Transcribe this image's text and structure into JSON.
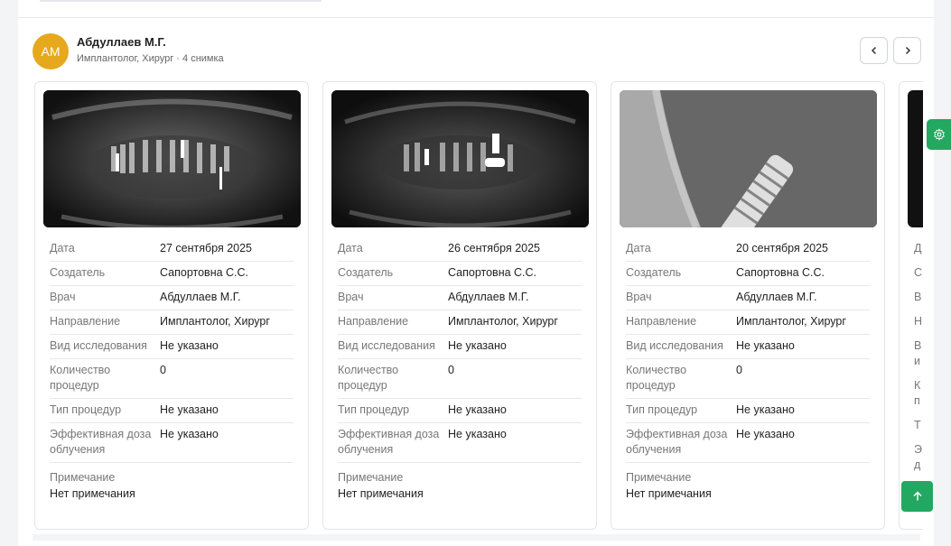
{
  "doctor": {
    "initials": "АМ",
    "name": "Абдуллаев М.Г.",
    "subtitle": "Имплантолог, Хирург · 4 снимка",
    "avatar_color": "#e6a91d"
  },
  "nav": {
    "prev_icon": "chevron-left-icon",
    "next_icon": "chevron-right-icon"
  },
  "labels": {
    "date": "Дата",
    "creator": "Создатель",
    "doctor": "Врач",
    "direction": "Направление",
    "study_type": "Вид исследования",
    "procedures_count": "Количество процедур",
    "procedure_type": "Тип процедур",
    "effective_dose": "Эффективная доза облучения",
    "note": "Примечание"
  },
  "cards": [
    {
      "image": "panoramic-xray",
      "date": "27 сентября 2025",
      "creator": "Сапортовна С.С.",
      "doctor": "Абдуллаев М.Г.",
      "direction": "Имплантолог, Хирург",
      "study_type": "Не указано",
      "procedures_count": "0",
      "procedure_type": "Не указано",
      "effective_dose": "Не указано",
      "note": "Нет примечания"
    },
    {
      "image": "panoramic-xray",
      "date": "26 сентября 2025",
      "creator": "Сапортовна С.С.",
      "doctor": "Абдуллаев М.Г.",
      "direction": "Имплантолог, Хирург",
      "study_type": "Не указано",
      "procedures_count": "0",
      "procedure_type": "Не указано",
      "effective_dose": "Не указано",
      "note": "Нет примечания"
    },
    {
      "image": "implant-closeup-xray",
      "date": "20 сентября 2025",
      "creator": "Сапортовна С.С.",
      "doctor": "Абдуллаев М.Г.",
      "direction": "Имплантолог, Хирург",
      "study_type": "Не указано",
      "procedures_count": "0",
      "procedure_type": "Не указано",
      "effective_dose": "Не указано",
      "note": "Нет примечания"
    }
  ],
  "partial_card_labels": [
    "Д",
    "С",
    "В",
    "Н",
    "В",
    "и",
    "К",
    "п",
    "Т",
    "Э",
    "д"
  ],
  "accent_color": "#22a860",
  "icons": {
    "settings": "gear-icon",
    "scroll_top": "arrow-up-icon"
  }
}
